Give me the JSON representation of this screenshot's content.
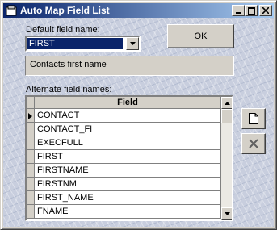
{
  "window": {
    "title": "Auto Map Field List"
  },
  "title_buttons": {
    "minimize": "minimize-icon",
    "maximize": "maximize-icon",
    "close": "close-icon"
  },
  "default_field": {
    "label": "Default field name:",
    "value": "FIRST",
    "description": "Contacts first name"
  },
  "ok_button": {
    "label": "OK"
  },
  "alternate": {
    "label": "Alternate field names:",
    "column_header": "Field",
    "rows": [
      "CONTACT",
      "CONTACT_FI",
      "EXECFULL",
      "FIRST",
      "FIRSTNAME",
      "FIRSTNM",
      "FIRST_NAME",
      "FNAME"
    ]
  },
  "side_buttons": {
    "new": "new-document-icon",
    "delete": "delete-x-icon"
  },
  "colors": {
    "title_start": "#0a246a",
    "title_end": "#a6caf0",
    "selection": "#0a246a"
  }
}
